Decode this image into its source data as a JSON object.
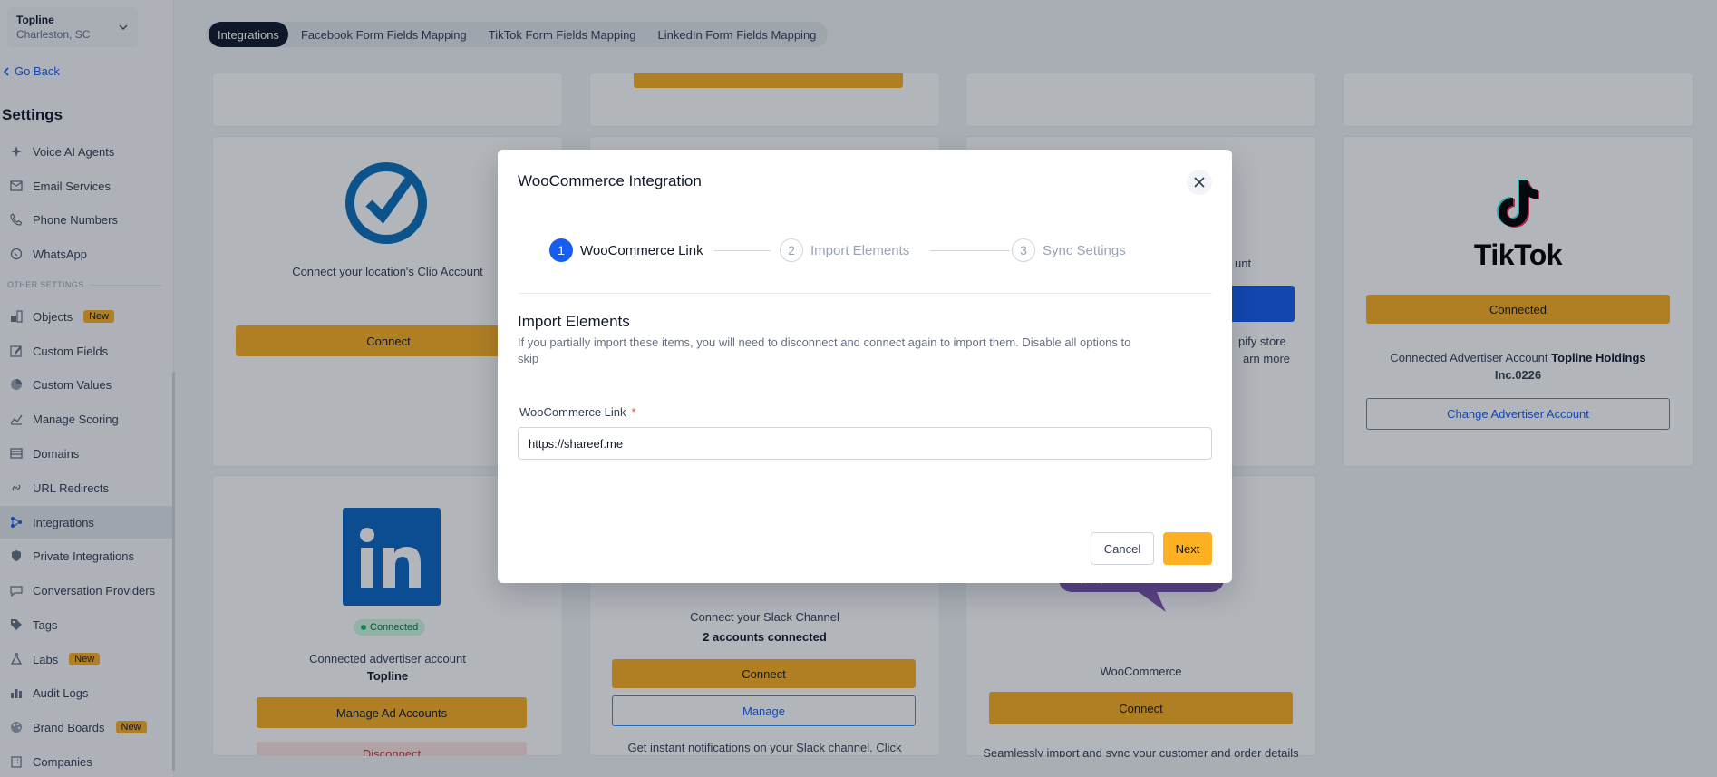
{
  "location": {
    "name": "Topline",
    "city": "Charleston, SC"
  },
  "sidebar": {
    "back_label": "Go Back",
    "title": "Settings",
    "section_label": "OTHER SETTINGS",
    "new_badge": "New",
    "items": [
      {
        "label": "Voice AI Agents",
        "icon": "sparkle-icon"
      },
      {
        "label": "Email Services",
        "icon": "envelope-icon"
      },
      {
        "label": "Phone Numbers",
        "icon": "phone-icon"
      },
      {
        "label": "WhatsApp",
        "icon": "whatsapp-icon"
      },
      {
        "label": "Objects",
        "icon": "objects-icon",
        "badge": "New"
      },
      {
        "label": "Custom Fields",
        "icon": "edit-icon"
      },
      {
        "label": "Custom Values",
        "icon": "pie-icon"
      },
      {
        "label": "Manage Scoring",
        "icon": "chart-icon"
      },
      {
        "label": "Domains",
        "icon": "domain-icon"
      },
      {
        "label": "URL Redirects",
        "icon": "link-icon"
      },
      {
        "label": "Integrations",
        "icon": "integrations-icon",
        "active": true
      },
      {
        "label": "Private Integrations",
        "icon": "shield-icon"
      },
      {
        "label": "Conversation Providers",
        "icon": "chat-icon"
      },
      {
        "label": "Tags",
        "icon": "tag-icon"
      },
      {
        "label": "Labs",
        "icon": "flask-icon",
        "badge": "New"
      },
      {
        "label": "Audit Logs",
        "icon": "bars-icon"
      },
      {
        "label": "Brand Boards",
        "icon": "palette-icon",
        "badge": "New"
      },
      {
        "label": "Companies",
        "icon": "building-icon"
      }
    ]
  },
  "tabs": [
    {
      "label": "Integrations",
      "active": true
    },
    {
      "label": "Facebook Form Fields Mapping"
    },
    {
      "label": "TikTok Form Fields Mapping"
    },
    {
      "label": "LinkedIn Form Fields Mapping"
    }
  ],
  "cards": {
    "clio": {
      "text": "Connect your location's Clio Account",
      "button": "Connect"
    },
    "shopify": {
      "text_top": "unt",
      "text_line1": "pify store",
      "text_line2": "arn more"
    },
    "tiktok": {
      "logo_text": "TikTok",
      "button": "Connected",
      "account_prefix": "Connected Advertiser Account",
      "account_name_1": "Topline Holdings",
      "account_name_2": "Inc.0226",
      "change_button": "Change Advertiser Account"
    },
    "linkedin": {
      "status": "Connected",
      "account_label": "Connected advertiser account",
      "account_name": "Topline",
      "manage_button": "Manage Ad Accounts",
      "disconnect_button": "Disconnect"
    },
    "slack": {
      "text": "Connect your Slack Channel",
      "accounts": "2 accounts connected",
      "connect_button": "Connect",
      "manage_button": "Manage",
      "footer": "Get instant notifications on your Slack channel. Click"
    },
    "woocommerce": {
      "name": "WooCommerce",
      "button": "Connect",
      "footer": "Seamlessly import and sync your customer and order details"
    }
  },
  "modal": {
    "title": "WooCommerce Integration",
    "steps": [
      {
        "num": "1",
        "label": "WooCommerce Link",
        "active": true
      },
      {
        "num": "2",
        "label": "Import Elements"
      },
      {
        "num": "3",
        "label": "Sync Settings"
      }
    ],
    "section_title": "Import Elements",
    "section_desc": "If you partially import these items, you will need to disconnect and connect again to import them. Disable all options to skip",
    "field_label": "WooCommerce Link",
    "field_required": "*",
    "field_value": "https://shareef.me",
    "cancel_label": "Cancel",
    "next_label": "Next"
  },
  "colors": {
    "accent": "#fdb022",
    "primary": "#155eef",
    "active_tab": "#101828"
  }
}
